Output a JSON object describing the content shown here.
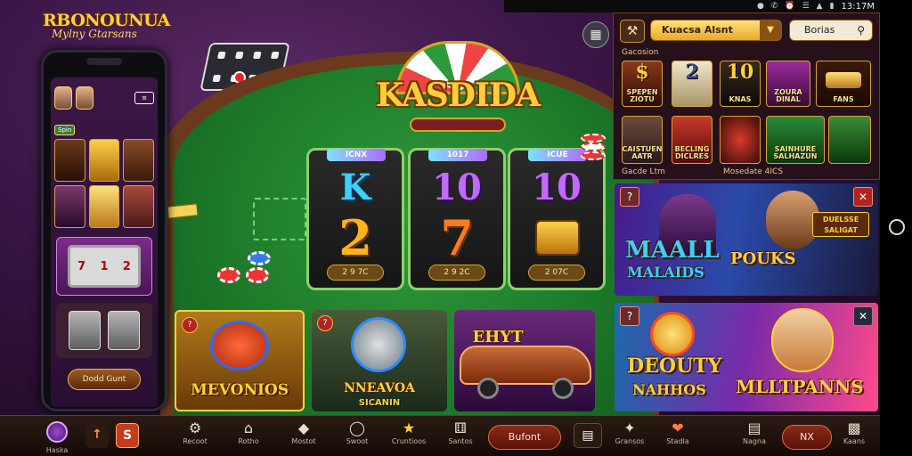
{
  "status_bar": {
    "time": "13:17M",
    "icons": [
      "notification-icon",
      "whatsapp-icon",
      "alarm-icon",
      "wifi-icon",
      "signal-icon",
      "battery-icon"
    ]
  },
  "brand": {
    "title": "RBONOUNUA",
    "subtitle": "Mylny Gtarsans"
  },
  "phone": {
    "badge": "Spin",
    "tiles": [
      "",
      "",
      "",
      "",
      "",
      "",
      "",
      "",
      ""
    ],
    "slot_symbols": [
      "7",
      "1",
      "2"
    ],
    "button_label": "Dodd Gunt"
  },
  "logo": {
    "title": "KASDIDA"
  },
  "reels": [
    {
      "tag": "ICNX",
      "top_symbol": "K",
      "bottom_symbol": "2",
      "amount": "2 9 7C"
    },
    {
      "tag": "1017",
      "top_symbol": "10",
      "bottom_symbol": "7",
      "amount": "2 9 2C"
    },
    {
      "tag": "ICUE",
      "top_symbol": "10",
      "bottom_symbol": "",
      "amount": "2 07C"
    }
  ],
  "game_cards": [
    {
      "badge": "?",
      "title": "MEVONIOS",
      "subtitle": ""
    },
    {
      "badge": "7",
      "title": "NNEAVOA",
      "subtitle": "SICANIN"
    },
    {
      "badge": "",
      "title": "EHYT",
      "subtitle": ""
    }
  ],
  "panel": {
    "tool_icon": "hammer-icon",
    "select_value": "Kuacsa Alsnt",
    "search_value": "Borias",
    "section_top": "Gacosion",
    "section_bottom_left": "Gacde Ltm",
    "section_bottom_right": "Mosedate 4ICS",
    "tiles_row1": [
      {
        "big": "$",
        "label": "SPEPEN ZIOTU"
      },
      {
        "big": "2",
        "label": ""
      },
      {
        "big": "10",
        "label": "KNAS"
      },
      {
        "big": "",
        "label": "ZOURA DINAL"
      },
      {
        "big": "",
        "label": "FANS"
      }
    ],
    "tiles_row2": [
      {
        "big": "",
        "label": "CAISTUEN AATR"
      },
      {
        "big": "",
        "label": "BECLING DICLRES"
      },
      {
        "big": "",
        "label": ""
      },
      {
        "big": "",
        "label": "SAINHURE SALHAZUN"
      },
      {
        "big": "",
        "label": ""
      }
    ]
  },
  "banners": [
    {
      "badge": "?",
      "title_line1": "MAALL",
      "title_line2": "MALAIDS",
      "right_title": "POUKS",
      "right_sign": "DUELSSE SALIGAT"
    },
    {
      "badge": "?",
      "title_line1": "DEOUTY",
      "title_line2": "NAHHOS",
      "right_title": "MLLTPANNS"
    }
  ],
  "bottom_nav": {
    "profile_label": "Haska",
    "items": [
      "Recoot",
      "Rotho",
      "Mostot",
      "Swoot",
      "Cruntioos",
      "Santos",
      "Gransos",
      "Stadla",
      "Nagna",
      "Kaans"
    ],
    "pill_left": "Bufont",
    "pill_right": "NX"
  }
}
